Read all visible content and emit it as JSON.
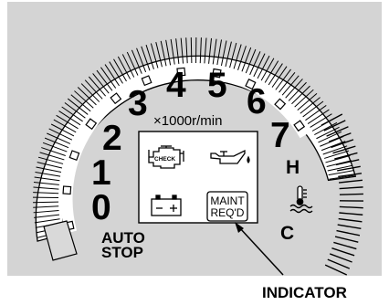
{
  "tachometer": {
    "scale_numbers": [
      "0",
      "1",
      "2",
      "3",
      "4",
      "5",
      "6",
      "7"
    ],
    "unit_label": "×1000r/min",
    "auto_stop_line1": "AUTO",
    "auto_stop_line2": "STOP"
  },
  "temperature_gauge": {
    "hot_label": "H",
    "cold_label": "C"
  },
  "warning_panel": {
    "check_engine_text": "CHECK",
    "maint_line1": "MAINT",
    "maint_line2": "REQ'D"
  },
  "callout": {
    "label": "INDICATOR"
  },
  "colors": {
    "panel_background": "#d4d4d4",
    "line": "#000000",
    "face": "#ffffff"
  }
}
